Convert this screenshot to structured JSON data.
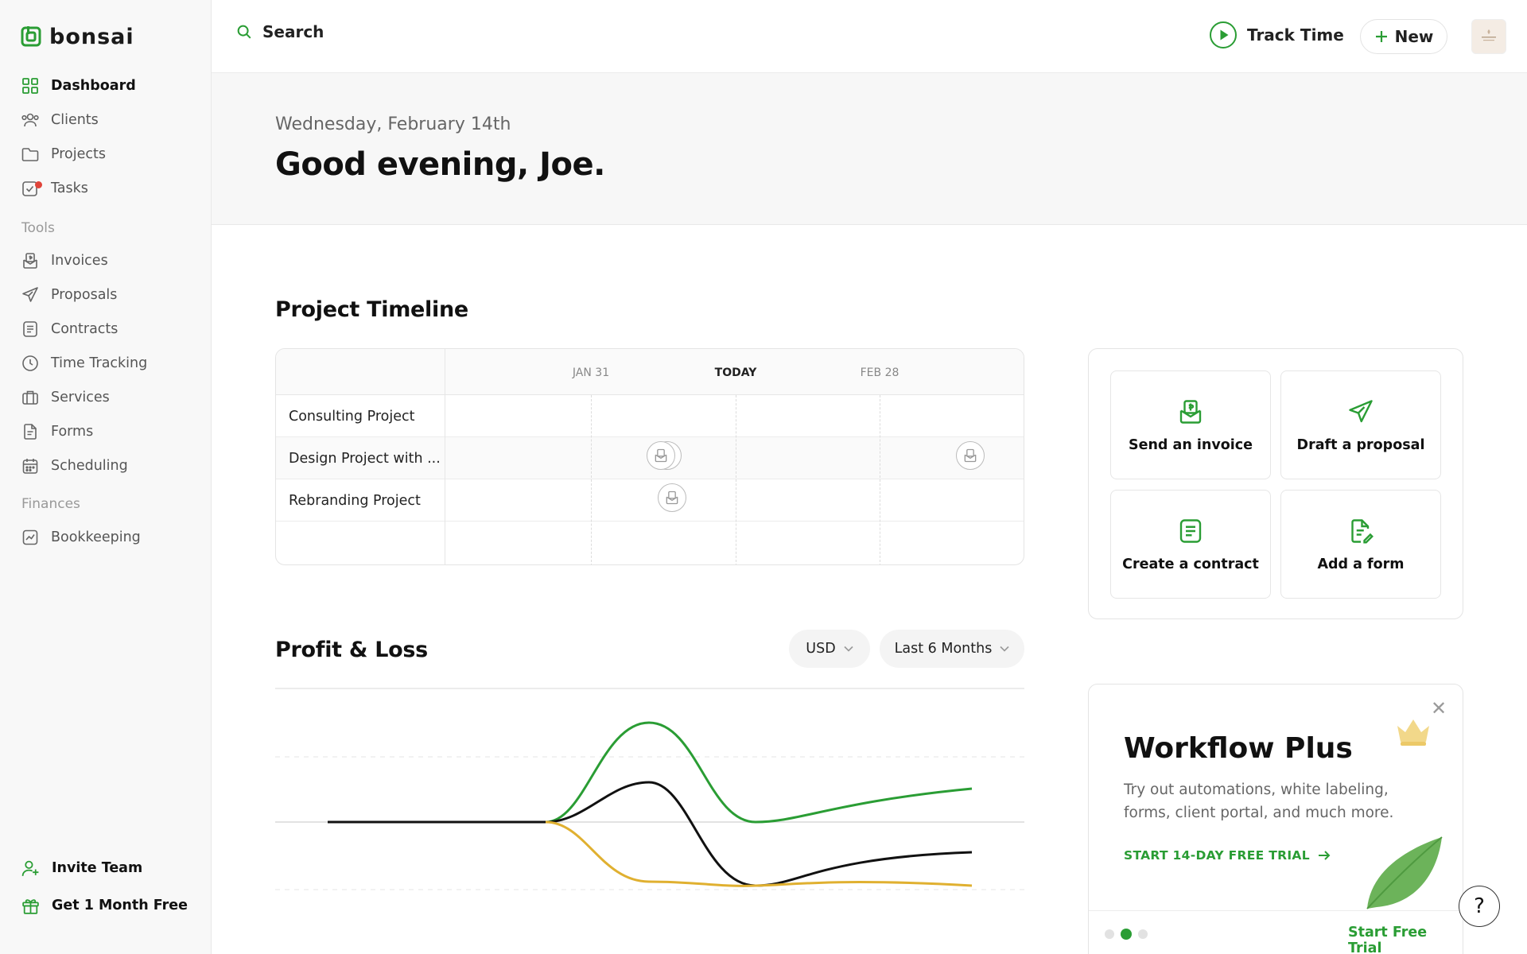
{
  "app": {
    "name": "bonsai"
  },
  "sidebar": {
    "items": [
      {
        "label": "Dashboard",
        "icon": "dashboard-icon"
      },
      {
        "label": "Clients",
        "icon": "clients-icon"
      },
      {
        "label": "Projects",
        "icon": "folder-icon"
      },
      {
        "label": "Tasks",
        "icon": "tasks-icon"
      }
    ],
    "tools_heading": "Tools",
    "tools": [
      {
        "label": "Invoices",
        "icon": "invoice-icon"
      },
      {
        "label": "Proposals",
        "icon": "paper-plane-icon"
      },
      {
        "label": "Contracts",
        "icon": "contract-icon"
      },
      {
        "label": "Time Tracking",
        "icon": "clock-icon"
      },
      {
        "label": "Services",
        "icon": "briefcase-icon"
      },
      {
        "label": "Forms",
        "icon": "form-icon"
      },
      {
        "label": "Scheduling",
        "icon": "calendar-icon"
      }
    ],
    "finances_heading": "Finances",
    "finances": [
      {
        "label": "Bookkeeping",
        "icon": "chart-icon"
      }
    ],
    "invite_team": "Invite Team",
    "get_free": "Get 1 Month Free"
  },
  "topbar": {
    "search": "Search",
    "track_time": "Track Time",
    "new": "New"
  },
  "greeting": {
    "date": "Wednesday, February 14th",
    "title": "Good evening, Joe."
  },
  "timeline": {
    "title": "Project Timeline",
    "dates": [
      "JAN 31",
      "TODAY",
      "FEB 28"
    ],
    "rows": [
      "Consulting Project",
      "Design Project with ...",
      "Rebranding Project"
    ]
  },
  "actions": [
    {
      "label": "Send an invoice",
      "icon": "invoice-icon"
    },
    {
      "label": "Draft a proposal",
      "icon": "paper-plane-icon"
    },
    {
      "label": "Create a contract",
      "icon": "contract-icon"
    },
    {
      "label": "Add a form",
      "icon": "form-edit-icon"
    }
  ],
  "pnl": {
    "title": "Profit & Loss",
    "currency": "USD",
    "range": "Last 6 Months"
  },
  "promo": {
    "title": "Workflow Plus",
    "text": "Try out automations, white labeling, forms, client portal, and much more.",
    "link": "START 14-DAY FREE TRIAL",
    "cta": "Start Free Trial"
  },
  "colors": {
    "brand": "#2a9d34",
    "expense": "#e0b030",
    "profit": "#111111"
  }
}
